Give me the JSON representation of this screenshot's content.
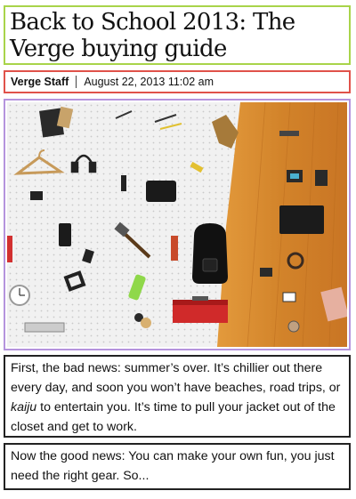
{
  "article": {
    "title": "Back to School 2013: The Verge buying guide",
    "author": "Verge Staff",
    "date": "August 22, 2013 11:02 am",
    "paragraph1": {
      "before": "First, the bad news: summer’s over. It’s chillier out there every day, and soon you won’t have beaches, road trips, or ",
      "emphasis": "kaiju",
      "after": " to entertain you. It’s time to pull your jacket out of the closet and get to work."
    },
    "paragraph2": "Now the good news: You can make your own fun, you just need the right gear. So..."
  },
  "colors": {
    "title_border": "#a8d44a",
    "byline_border": "#e0524a",
    "image_border": "#b594dd",
    "text_border": "#222222",
    "pegboard": "#f2f2f2",
    "wood": "#d98a2c"
  },
  "image_icons": [
    "hanger-icon",
    "headphones-icon",
    "tablet-icon",
    "hammer-icon",
    "backpack-icon",
    "toolbox-icon",
    "camera-icon",
    "clock-icon",
    "phone-icon",
    "bottle-icon"
  ]
}
